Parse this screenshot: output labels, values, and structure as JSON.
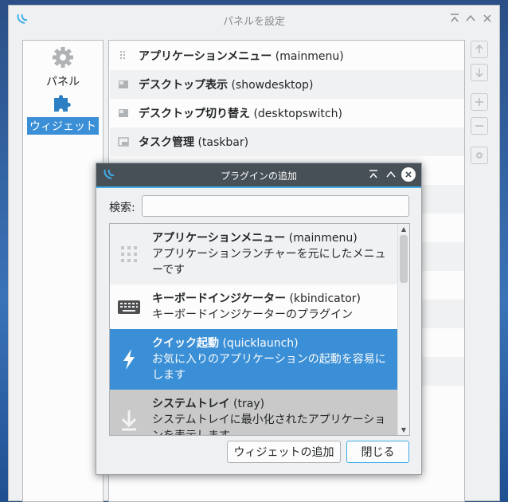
{
  "main_window": {
    "title": "パネルを設定",
    "categories": [
      {
        "label": "パネル",
        "icon": "gear-icon"
      },
      {
        "label": "ウィジェット",
        "icon": "puzzle-icon",
        "selected": true
      }
    ],
    "plugins": [
      {
        "name": "アプリケーションメニュー",
        "id": "(mainmenu)",
        "icon": "grip-icon"
      },
      {
        "name": "デスクトップ表示",
        "id": "(showdesktop)",
        "icon": "desktop-icon"
      },
      {
        "name": "デスクトップ切り替え",
        "id": "(desktopswitch)",
        "icon": "desktop-icon"
      },
      {
        "name": "タスク管理",
        "id": "(taskbar)",
        "icon": "taskbar-icon"
      }
    ]
  },
  "dialog": {
    "title": "プラグインの追加",
    "search_label": "検索:",
    "search_value": "",
    "items": [
      {
        "name": "アプリケーションメニュー",
        "id": "(mainmenu)",
        "desc": "アプリケーションランチャーを元にしたメニューです",
        "icon": "grip-icon"
      },
      {
        "name": "キーボードインジケーター",
        "id": "(kbindicator)",
        "desc": "キーボードインジケーターのプラグイン",
        "icon": "keyboard-icon"
      },
      {
        "name": "クイック起動",
        "id": "(quicklaunch)",
        "desc": "お気に入りのアプリケーションの起動を容易にします",
        "icon": "lightning-icon"
      },
      {
        "name": "システムトレイ",
        "id": "(tray)",
        "desc": "システムトレイに最小化されたアプリケーションを表示します",
        "icon": "download-arrow-icon"
      }
    ],
    "add_button": "ウィジェットの追加",
    "close_button": "閉じる"
  },
  "colors": {
    "accent": "#3daee9",
    "selection": "#3a8fd6",
    "dialog_titlebar": "#475057"
  }
}
